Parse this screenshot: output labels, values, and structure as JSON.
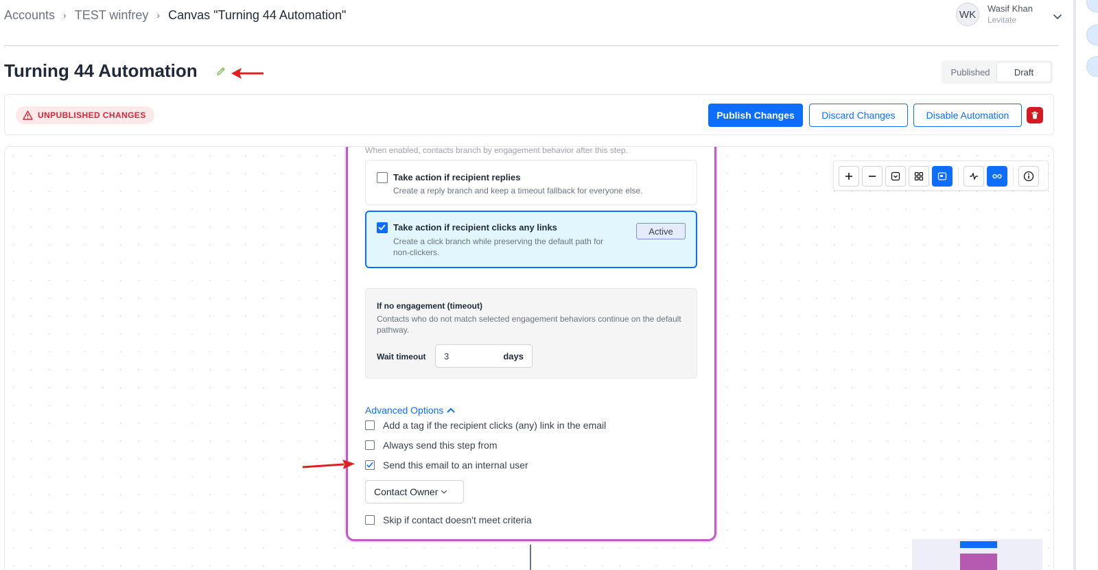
{
  "breadcrumb": {
    "items": [
      "Accounts",
      "TEST winfrey"
    ],
    "separator": "›",
    "current": "Canvas \"Turning 44 Automation\""
  },
  "user": {
    "initials": "WK",
    "name": "Wasif Khan",
    "org": "Levitate"
  },
  "page": {
    "title": "Turning 44 Automation"
  },
  "status_toggle": {
    "options": [
      "Published",
      "Draft"
    ],
    "selected": "Draft"
  },
  "action_bar": {
    "badge": "UNPUBLISHED CHANGES",
    "publish": "Publish Changes",
    "discard": "Discard Changes",
    "disable": "Disable Automation"
  },
  "node": {
    "truncated_text": "When enabled, contacts branch by engagement behavior after this step.",
    "options": [
      {
        "title": "Take action if recipient replies",
        "description": "Create a reply branch and keep a timeout fallback for everyone else.",
        "checked": false
      },
      {
        "title": "Take action if recipient clicks any links",
        "description_line1": "Create a click branch while preserving the default path for",
        "description_line2": "non-clickers.",
        "checked": true,
        "badge": "Active"
      }
    ],
    "timeout": {
      "title": "If no engagement (timeout)",
      "description": "Contacts who do not match selected engagement behaviors continue on the default pathway.",
      "wait_label": "Wait timeout",
      "wait_value": "3",
      "wait_unit": "days"
    },
    "advanced": {
      "toggle_label": "Advanced Options",
      "expanded": true,
      "items": [
        {
          "label": "Add a tag if the recipient clicks (any) link in the email",
          "checked": false
        },
        {
          "label": "Always send this step from",
          "checked": false
        },
        {
          "label": "Send this email to an internal user",
          "checked": true
        }
      ],
      "owner_select": "Contact Owner",
      "skip_label": "Skip if contact doesn't meet criteria",
      "skip_checked": false
    }
  },
  "colors": {
    "primary": "#0d6efd",
    "danger": "#d21b23",
    "node_border": "#c25bc1",
    "annotation_arrow": "#e02020"
  }
}
